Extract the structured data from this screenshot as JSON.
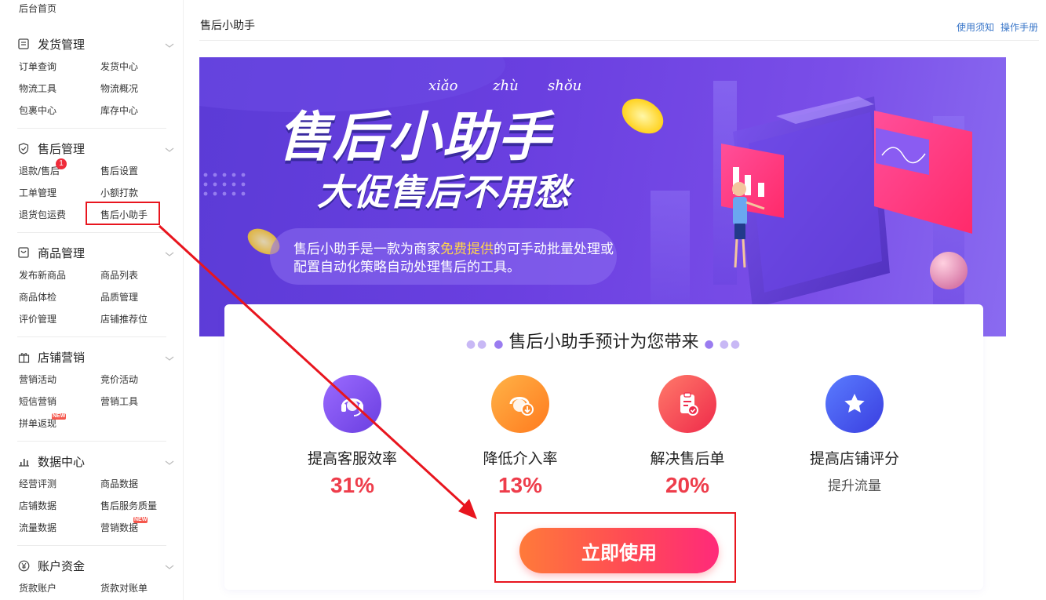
{
  "sidebar": {
    "home": "后台首页",
    "groups": [
      {
        "title": "发货管理",
        "icon": "document-icon",
        "items": [
          "订单查询",
          "发货中心",
          "物流工具",
          "物流概况",
          "包裹中心",
          "库存中心"
        ]
      },
      {
        "title": "售后管理",
        "icon": "shield-icon",
        "items": [
          "退款/售后",
          "售后设置",
          "工单管理",
          "小额打款",
          "退货包运费",
          "售后小助手"
        ],
        "badge": "1"
      },
      {
        "title": "商品管理",
        "icon": "product-box-icon",
        "items": [
          "发布新商品",
          "商品列表",
          "商品体检",
          "品质管理",
          "评价管理",
          "店铺推荐位"
        ]
      },
      {
        "title": "店铺营销",
        "icon": "gift-icon",
        "items": [
          "营销活动",
          "竞价活动",
          "短信营销",
          "营销工具",
          "拼单返现"
        ],
        "new_badge": "NEW"
      },
      {
        "title": "数据中心",
        "icon": "bar-chart-icon",
        "items": [
          "经营评测",
          "商品数据",
          "店铺数据",
          "售后服务质量",
          "流量数据",
          "营销数据"
        ],
        "new_badge": "NEW"
      },
      {
        "title": "账户资金",
        "icon": "yen-icon",
        "items": [
          "货款账户",
          "货款对账单"
        ]
      }
    ]
  },
  "header": {
    "title": "售后小助手",
    "links": [
      "使用须知",
      "操作手册"
    ]
  },
  "banner": {
    "pinyin": [
      "xiǎo",
      "zhù",
      "shǒu"
    ],
    "title": "售后小助手",
    "subtitle": "大促售后不用愁",
    "desc_pre": "售后小助手是一款为商家",
    "desc_highlight": "免费提供",
    "desc_post": "的可手动批量处理或配置自动化策略自动处理售后的工具。"
  },
  "card": {
    "title": "售后小助手预计为您带来",
    "benefits": [
      {
        "label": "提高客服效率",
        "value": "31%",
        "icon": "headset-icon",
        "color": "#7a4be8"
      },
      {
        "label": "降低介入率",
        "value": "13%",
        "icon": "service-down-icon",
        "color": "#ff8a2a"
      },
      {
        "label": "解决售后单",
        "value": "20%",
        "icon": "clipboard-check-icon",
        "color": "#f2475a"
      },
      {
        "label": "提高店铺评分",
        "sub": "提升流量",
        "icon": "star-icon",
        "color": "#3f5fe8"
      }
    ],
    "button": "立即使用"
  }
}
